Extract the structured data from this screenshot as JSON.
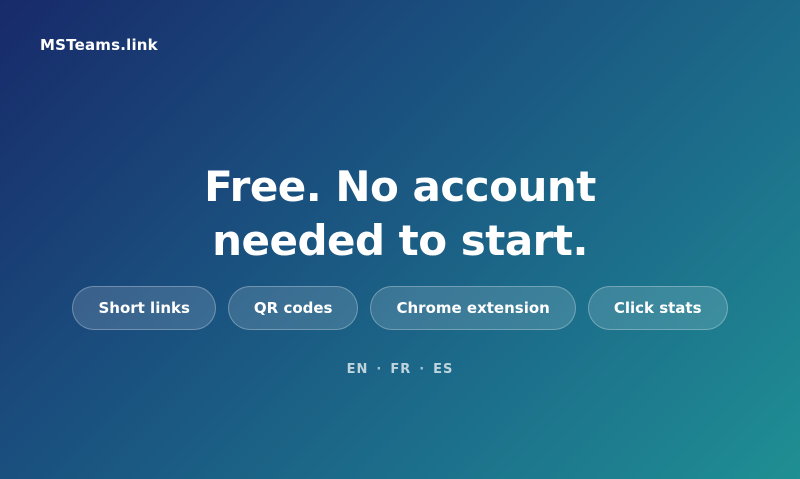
{
  "header": {
    "logo_text": "MSTeams.link"
  },
  "hero": {
    "headline_line1": "Free. No account",
    "headline_line2": "needed to start."
  },
  "features": [
    {
      "label": "Short links"
    },
    {
      "label": "QR codes"
    },
    {
      "label": "Chrome extension"
    },
    {
      "label": "Click stats"
    }
  ],
  "languages": {
    "items": [
      "EN",
      "FR",
      "ES"
    ],
    "separator": "·"
  },
  "colors": {
    "gradient_start": "#182a6a",
    "gradient_end": "#1f8f93",
    "text": "#ffffff"
  }
}
